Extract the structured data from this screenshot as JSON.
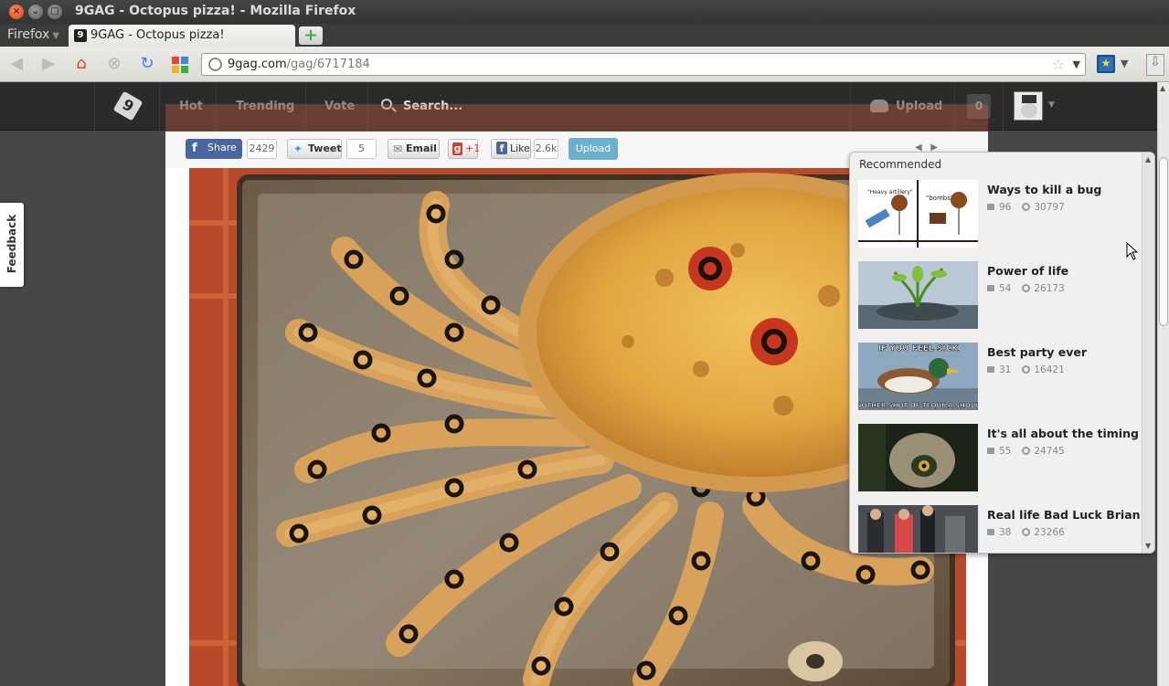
{
  "window": {
    "title": "9GAG - Octopus pizza! - Mozilla Firefox"
  },
  "tabs": {
    "menu_label": "Firefox",
    "active_tab": "9GAG - Octopus pizza!"
  },
  "urlbar": {
    "domain": "9gag.com",
    "path": "/gag/6717184"
  },
  "gag_nav": {
    "hot": "Hot",
    "trending": "Trending",
    "vote": "Vote",
    "search": "Search...",
    "upload": "Upload",
    "notifications": "0"
  },
  "feedback": "Feedback",
  "share": {
    "fb_share": "Share",
    "fb_count": "2429",
    "tweet": "Tweet",
    "tweet_count": "5",
    "email": "Email",
    "gplus": "+1",
    "like": "Like",
    "like_count": "2.6k",
    "upload": "Upload"
  },
  "recommended": {
    "title": "Recommended",
    "items": [
      {
        "name": "Ways to kill a bug",
        "comments": "96",
        "views": "30797",
        "thumb_text_1": "\"Heavy artillery\"",
        "thumb_text_2": "\"bombs\""
      },
      {
        "name": "Power of life",
        "comments": "54",
        "views": "26173"
      },
      {
        "name": "Best party ever",
        "comments": "31",
        "views": "16421",
        "thumb_top": "IF YOU FEEL SICK",
        "thumb_bottom": "ANOTHER SHOT OF TEQUILA SHOULD"
      },
      {
        "name": "It's all about the timing",
        "comments": "55",
        "views": "24745"
      },
      {
        "name": "Real life Bad Luck Brian",
        "comments": "38",
        "views": "23266"
      }
    ]
  },
  "colors": {
    "header_bg": "#2b2b2b",
    "accent_upload": "#6bb1cf",
    "fb_blue": "#4a66a0"
  }
}
